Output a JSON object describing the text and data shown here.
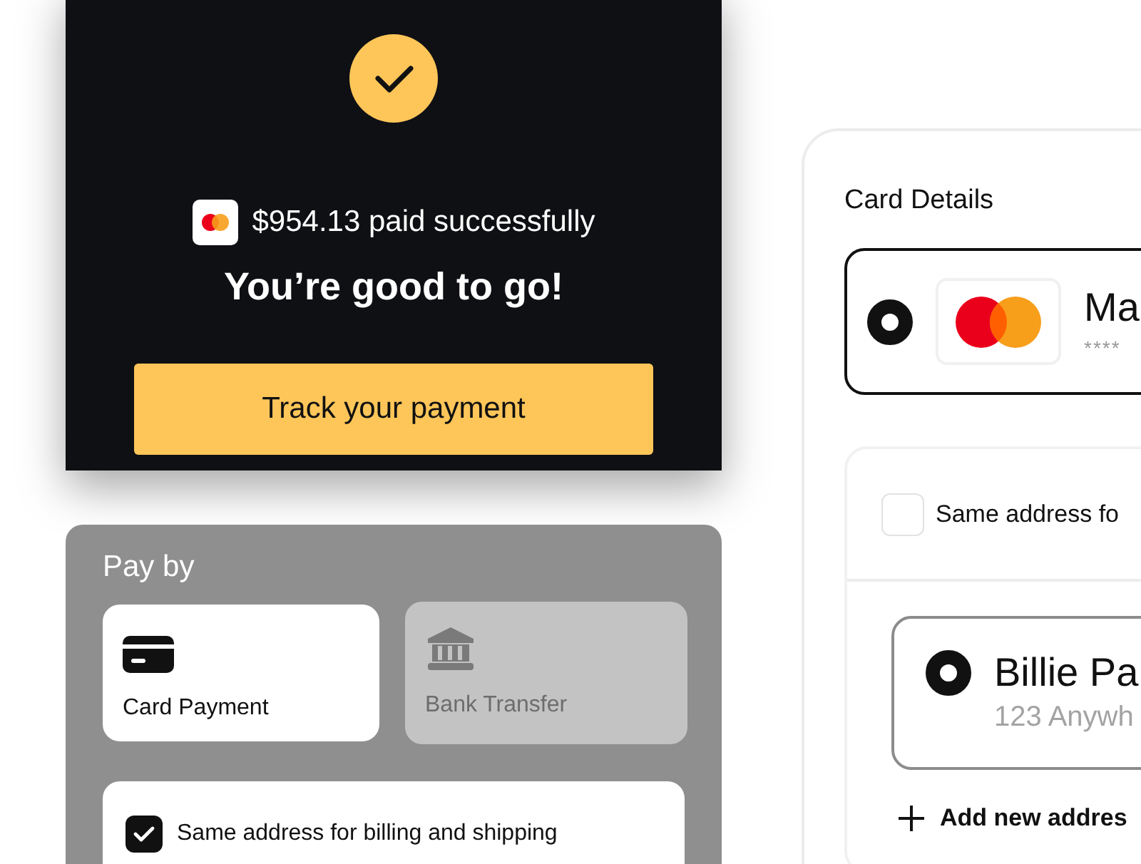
{
  "success_card": {
    "amount_text": "$954.13 paid successfully",
    "title": "You’re good to go!",
    "button": "Track your payment"
  },
  "pay_by": {
    "title": "Pay by",
    "options": [
      {
        "kind": "card",
        "label": "Card Payment",
        "selected": true
      },
      {
        "kind": "bank",
        "label": "Bank Transfer",
        "selected": false
      }
    ],
    "same_address": {
      "label": "Same address for billing and shipping",
      "checked": true
    }
  },
  "card_details": {
    "title": "Card Details",
    "card": {
      "name": "Ma",
      "number": "****",
      "selected": true
    },
    "same_address": {
      "label": "Same address fo",
      "checked": false
    },
    "address": {
      "name": "Billie Pa",
      "line": "123 Anywh",
      "selected": true
    },
    "add_address": "Add new addres"
  }
}
